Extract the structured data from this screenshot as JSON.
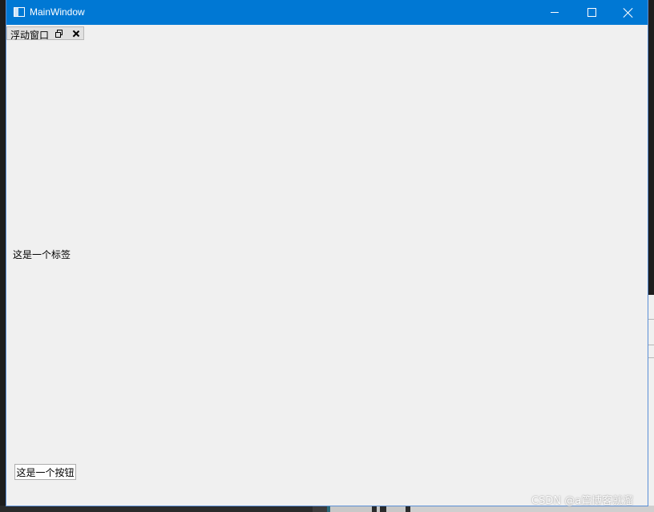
{
  "window": {
    "title": "MainWindow"
  },
  "dock": {
    "title": "浮动窗口"
  },
  "content": {
    "label_text": "这是一个标签",
    "button_label": "这是一个按钮"
  },
  "watermark": {
    "text": "CSDN @a篇博客就溜"
  },
  "colors": {
    "titlebar": "#0078d4",
    "client_bg": "#f0f0f0",
    "editor_bg": "#1e1e1e"
  },
  "icons": {
    "app": "window-app-icon",
    "minimize": "minimize-icon",
    "maximize": "maximize-icon",
    "close": "close-icon",
    "dock_float": "float-icon",
    "dock_close": "close-icon"
  }
}
